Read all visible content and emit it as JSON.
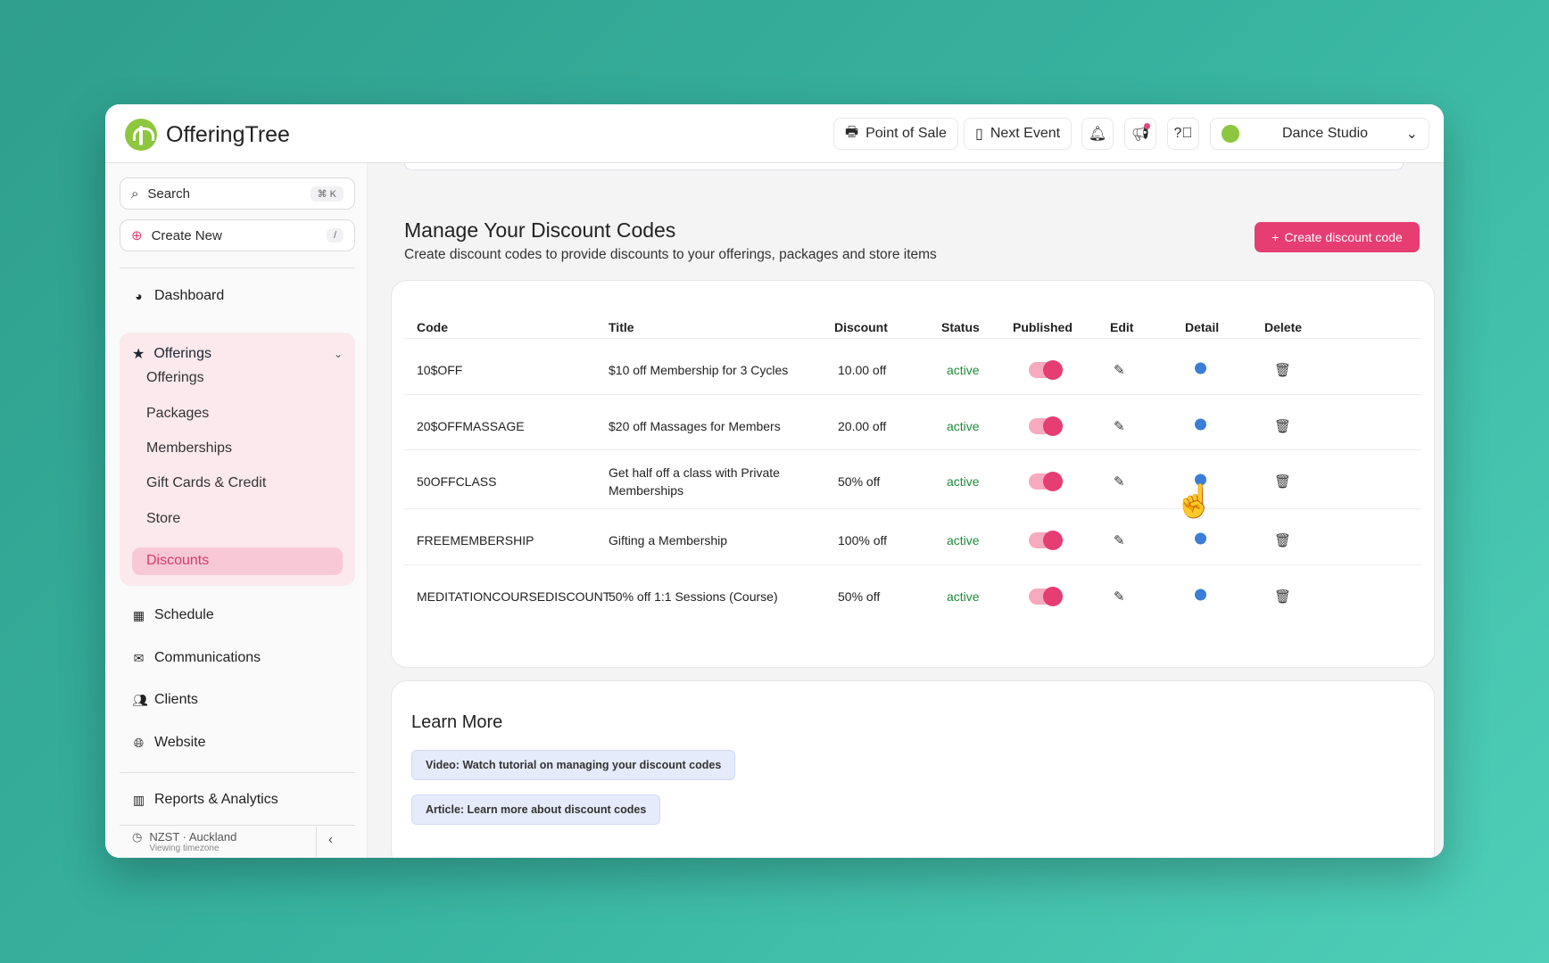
{
  "app": {
    "name": "OfferingTree"
  },
  "header": {
    "point_of_sale": "Point of Sale",
    "next_event": "Next Event",
    "studio": "Dance Studio"
  },
  "sidebar": {
    "search_label": "Search",
    "search_shortcut": "⌘ K",
    "create_label": "Create New",
    "create_shortcut": "/",
    "dashboard": "Dashboard",
    "offerings_group": "Offerings",
    "sub_items": [
      "Offerings",
      "Packages",
      "Memberships",
      "Gift Cards & Credit",
      "Store",
      "Discounts"
    ],
    "schedule": "Schedule",
    "communications": "Communications",
    "clients": "Clients",
    "website": "Website",
    "reports": "Reports & Analytics",
    "timezone": "NZST · Auckland",
    "timezone_sub": "Viewing timezone"
  },
  "main": {
    "title": "Manage Your Discount Codes",
    "subtitle": "Create discount codes to provide discounts to your offerings, packages and store items",
    "create_button": "Create discount code",
    "columns": [
      "Code",
      "Title",
      "Discount",
      "Status",
      "Published",
      "Edit",
      "Detail",
      "Delete"
    ],
    "rows": [
      {
        "code": "10$OFF",
        "title": "$10 off Membership for 3 Cycles",
        "title2": "",
        "discount": "10.00 off",
        "status": "active"
      },
      {
        "code": "20$OFFMASSAGE",
        "title": "$20 off Massages for Members",
        "title2": "",
        "discount": "20.00 off",
        "status": "active"
      },
      {
        "code": "50OFFCLASS",
        "title": "Get half off a class with Private",
        "title2": "Memberships",
        "discount": "50% off",
        "status": "active"
      },
      {
        "code": "FREEMEMBERSHIP",
        "title": "Gifting a Membership",
        "title2": "",
        "discount": "100% off",
        "status": "active"
      },
      {
        "code": "MEDITATIONCOURSEDISCOUNT",
        "title": "50% off 1:1 Sessions (Course)",
        "title2": "",
        "discount": "50% off",
        "status": "active"
      }
    ],
    "learn_more": {
      "title": "Learn More",
      "video": "Video: Watch tutorial on managing your discount codes",
      "article": "Article: Learn more about discount codes"
    }
  },
  "colors": {
    "accent": "#e63d73",
    "active_status": "#1f8a3a",
    "brand": "#8dc63f"
  }
}
